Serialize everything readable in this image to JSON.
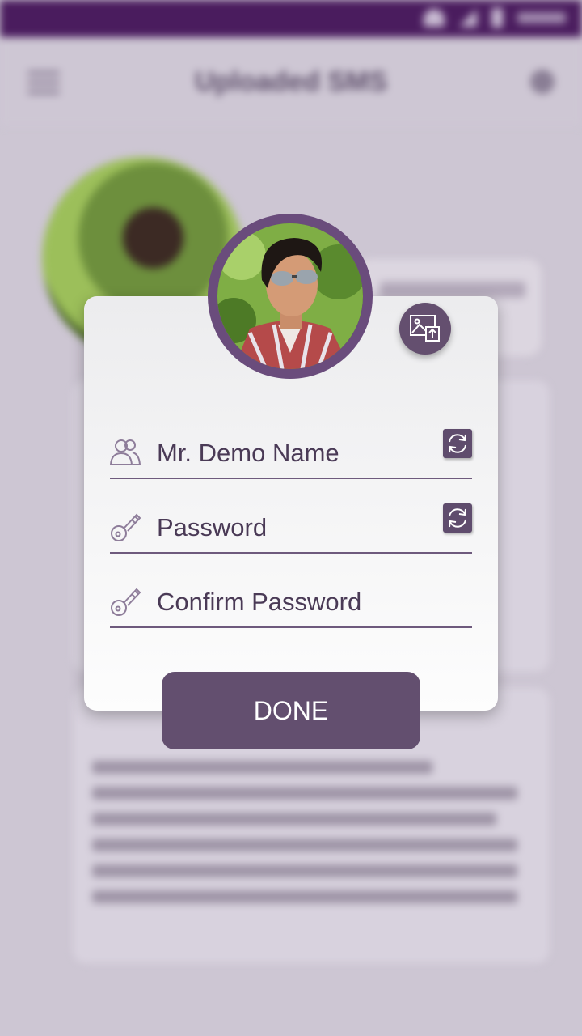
{
  "background": {
    "title": "Uploaded SMS"
  },
  "form": {
    "name_value": "Mr. Demo Name",
    "password_placeholder": "Password",
    "confirm_placeholder": "Confirm Password",
    "done_label": "DONE"
  },
  "icons": {
    "name_field": "user-group-icon",
    "password_field": "key-icon",
    "confirm_field": "key-icon",
    "refresh": "refresh-icon",
    "upload": "image-upload-icon"
  },
  "colors": {
    "status_bar": "#4a1c5e",
    "accent": "#634f6f",
    "text": "#4a3a56"
  }
}
